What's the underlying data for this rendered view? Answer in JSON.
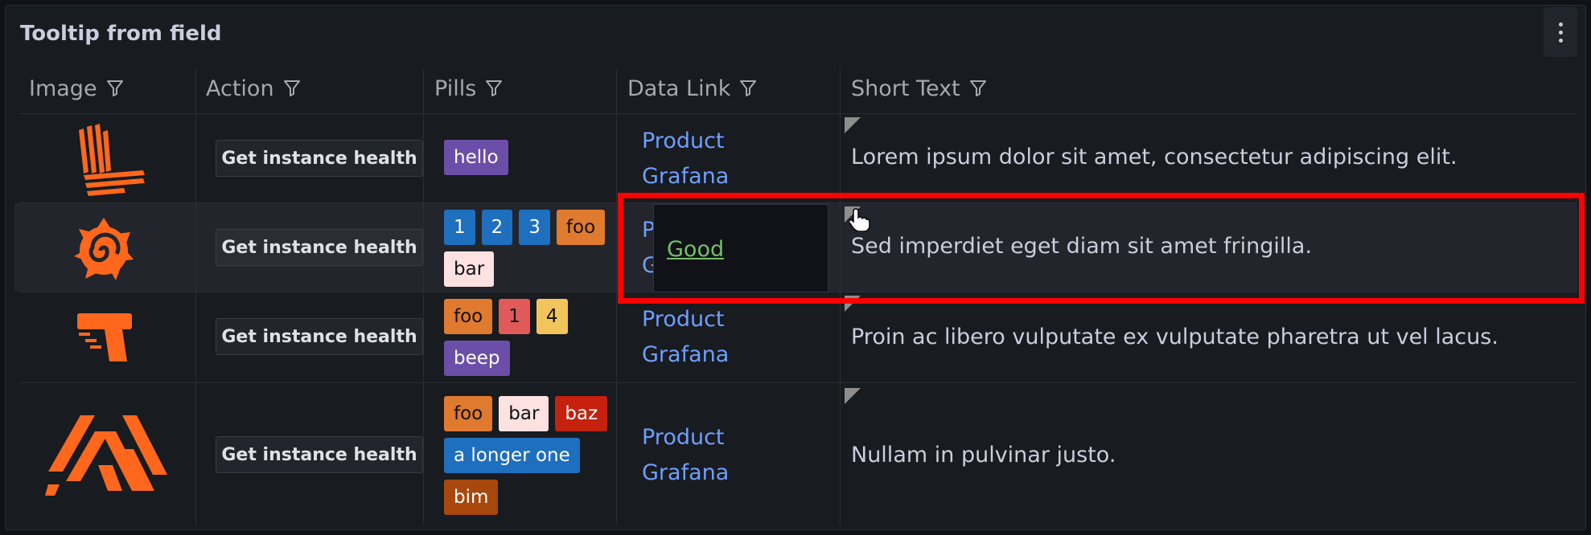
{
  "panel": {
    "title": "Tooltip from field"
  },
  "columns": [
    "Image",
    "Action",
    "Pills",
    "Data Link",
    "Short Text"
  ],
  "rows": [
    {
      "image": "loki-logo",
      "action": "Get instance health",
      "pills": [
        {
          "text": "hello",
          "bg": "#6b4ea8",
          "dark": false
        }
      ],
      "link": [
        "Product",
        "Grafana"
      ],
      "text": "Lorem ipsum dolor sit amet, consectetur adipiscing elit."
    },
    {
      "image": "grafana-logo",
      "action": "Get instance health",
      "pills": [
        {
          "text": "1",
          "bg": "#1f6fbf",
          "dark": false
        },
        {
          "text": "2",
          "bg": "#1f6fbf",
          "dark": false
        },
        {
          "text": "3",
          "bg": "#1f6fbf",
          "dark": false
        },
        {
          "text": "foo",
          "bg": "#e07a2e",
          "dark": true
        },
        {
          "text": "bar",
          "bg": "#fde2e1",
          "dark": true
        }
      ],
      "link": [
        "Pr",
        "Gr"
      ],
      "text": "Sed imperdiet eget diam sit amet fringilla."
    },
    {
      "image": "k6-logo",
      "action": "Get instance health",
      "pills": [
        {
          "text": "foo",
          "bg": "#e07a2e",
          "dark": true
        },
        {
          "text": "1",
          "bg": "#e05a5a",
          "dark": true
        },
        {
          "text": "4",
          "bg": "#f2c55c",
          "dark": true
        },
        {
          "text": "beep",
          "bg": "#6b4ea8",
          "dark": false
        }
      ],
      "link": [
        "Product",
        "Grafana"
      ],
      "text": "Proin ac libero vulputate ex vulputate pharetra ut vel lacus."
    },
    {
      "image": "mimir-logo",
      "action": "Get instance health",
      "pills": [
        {
          "text": "foo",
          "bg": "#e07a2e",
          "dark": true
        },
        {
          "text": "bar",
          "bg": "#fde2e1",
          "dark": true
        },
        {
          "text": "baz",
          "bg": "#c4210f",
          "dark": false
        },
        {
          "text": "a longer one",
          "bg": "#1f6fbf",
          "dark": false
        },
        {
          "text": "bim",
          "bg": "#a8480d",
          "dark": false
        }
      ],
      "link": [
        "Product",
        "Grafana"
      ],
      "text": "Nullam in pulvinar justo."
    }
  ],
  "tooltip": {
    "text": "Good"
  },
  "colors": {
    "accent": "#ff671d",
    "link": "#6e9fff",
    "tooltip_good": "#73bf69"
  },
  "icons": {
    "filter": "funnel-icon",
    "menu": "kebab-menu-icon"
  }
}
